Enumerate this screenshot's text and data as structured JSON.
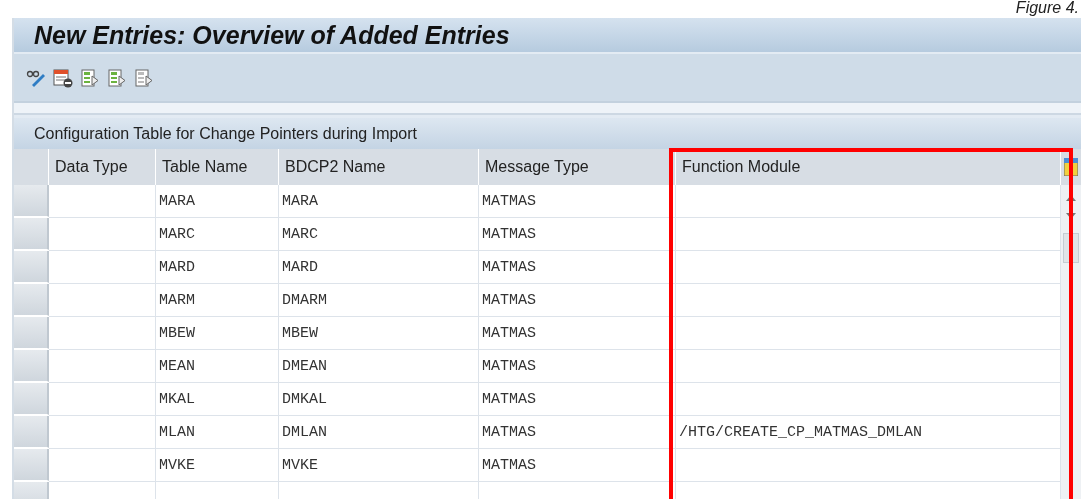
{
  "caption": "Figure 4.",
  "window": {
    "title": "New Entries: Overview of Added Entries"
  },
  "table": {
    "title": "Configuration Table for Change Pointers during Import",
    "columns": [
      "Data Type",
      "Table Name",
      "BDCP2 Name",
      "Message Type",
      "Function Module"
    ],
    "rows": [
      {
        "table_name": "MARA",
        "bdcp2_name": "MARA",
        "message_type": "MATMAS"
      },
      {
        "table_name": "MARC",
        "bdcp2_name": "MARC",
        "message_type": "MATMAS"
      },
      {
        "table_name": "MARD",
        "bdcp2_name": "MARD",
        "message_type": "MATMAS"
      },
      {
        "table_name": "MARM",
        "bdcp2_name": "DMARM",
        "message_type": "MATMAS"
      },
      {
        "table_name": "MBEW",
        "bdcp2_name": "MBEW",
        "message_type": "MATMAS"
      },
      {
        "table_name": "MEAN",
        "bdcp2_name": "DMEAN",
        "message_type": "MATMAS"
      },
      {
        "table_name": "MKAL",
        "bdcp2_name": "DMKAL",
        "message_type": "MATMAS"
      },
      {
        "table_name": "MLAN",
        "bdcp2_name": "DMLAN",
        "message_type": "MATMAS",
        "function_module": "/HTG/CREATE_CP_MATMAS_DMLAN"
      },
      {
        "table_name": "MVKE",
        "bdcp2_name": "MVKE",
        "message_type": "MATMAS"
      }
    ]
  }
}
